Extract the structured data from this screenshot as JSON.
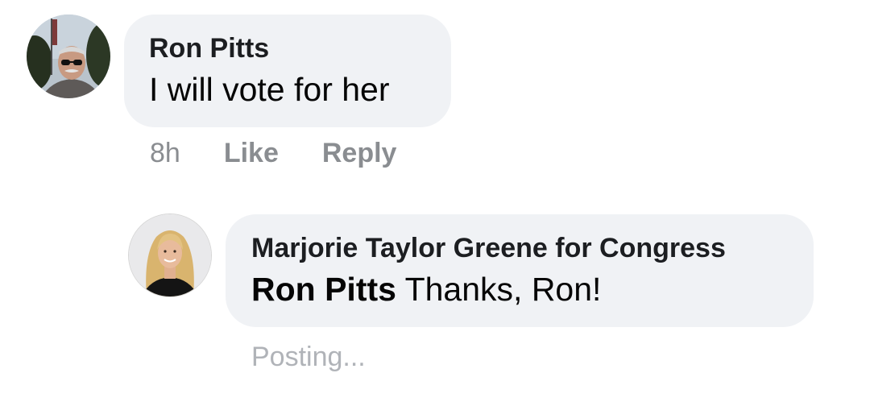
{
  "comments": [
    {
      "author": "Ron Pitts",
      "text": "I will vote for her",
      "time": "8h",
      "like_label": "Like",
      "reply_label": "Reply",
      "avatar_icon": "user-avatar-photo"
    }
  ],
  "reply": {
    "author": "Marjorie Taylor Greene for Congress",
    "mention": "Ron Pitts",
    "text": " Thanks, Ron!",
    "status": "Posting...",
    "avatar_icon": "page-avatar-photo"
  },
  "colors": {
    "bubble_bg": "#f0f2f5",
    "meta_text": "#8a8d91",
    "status_text": "#b0b3b8"
  }
}
